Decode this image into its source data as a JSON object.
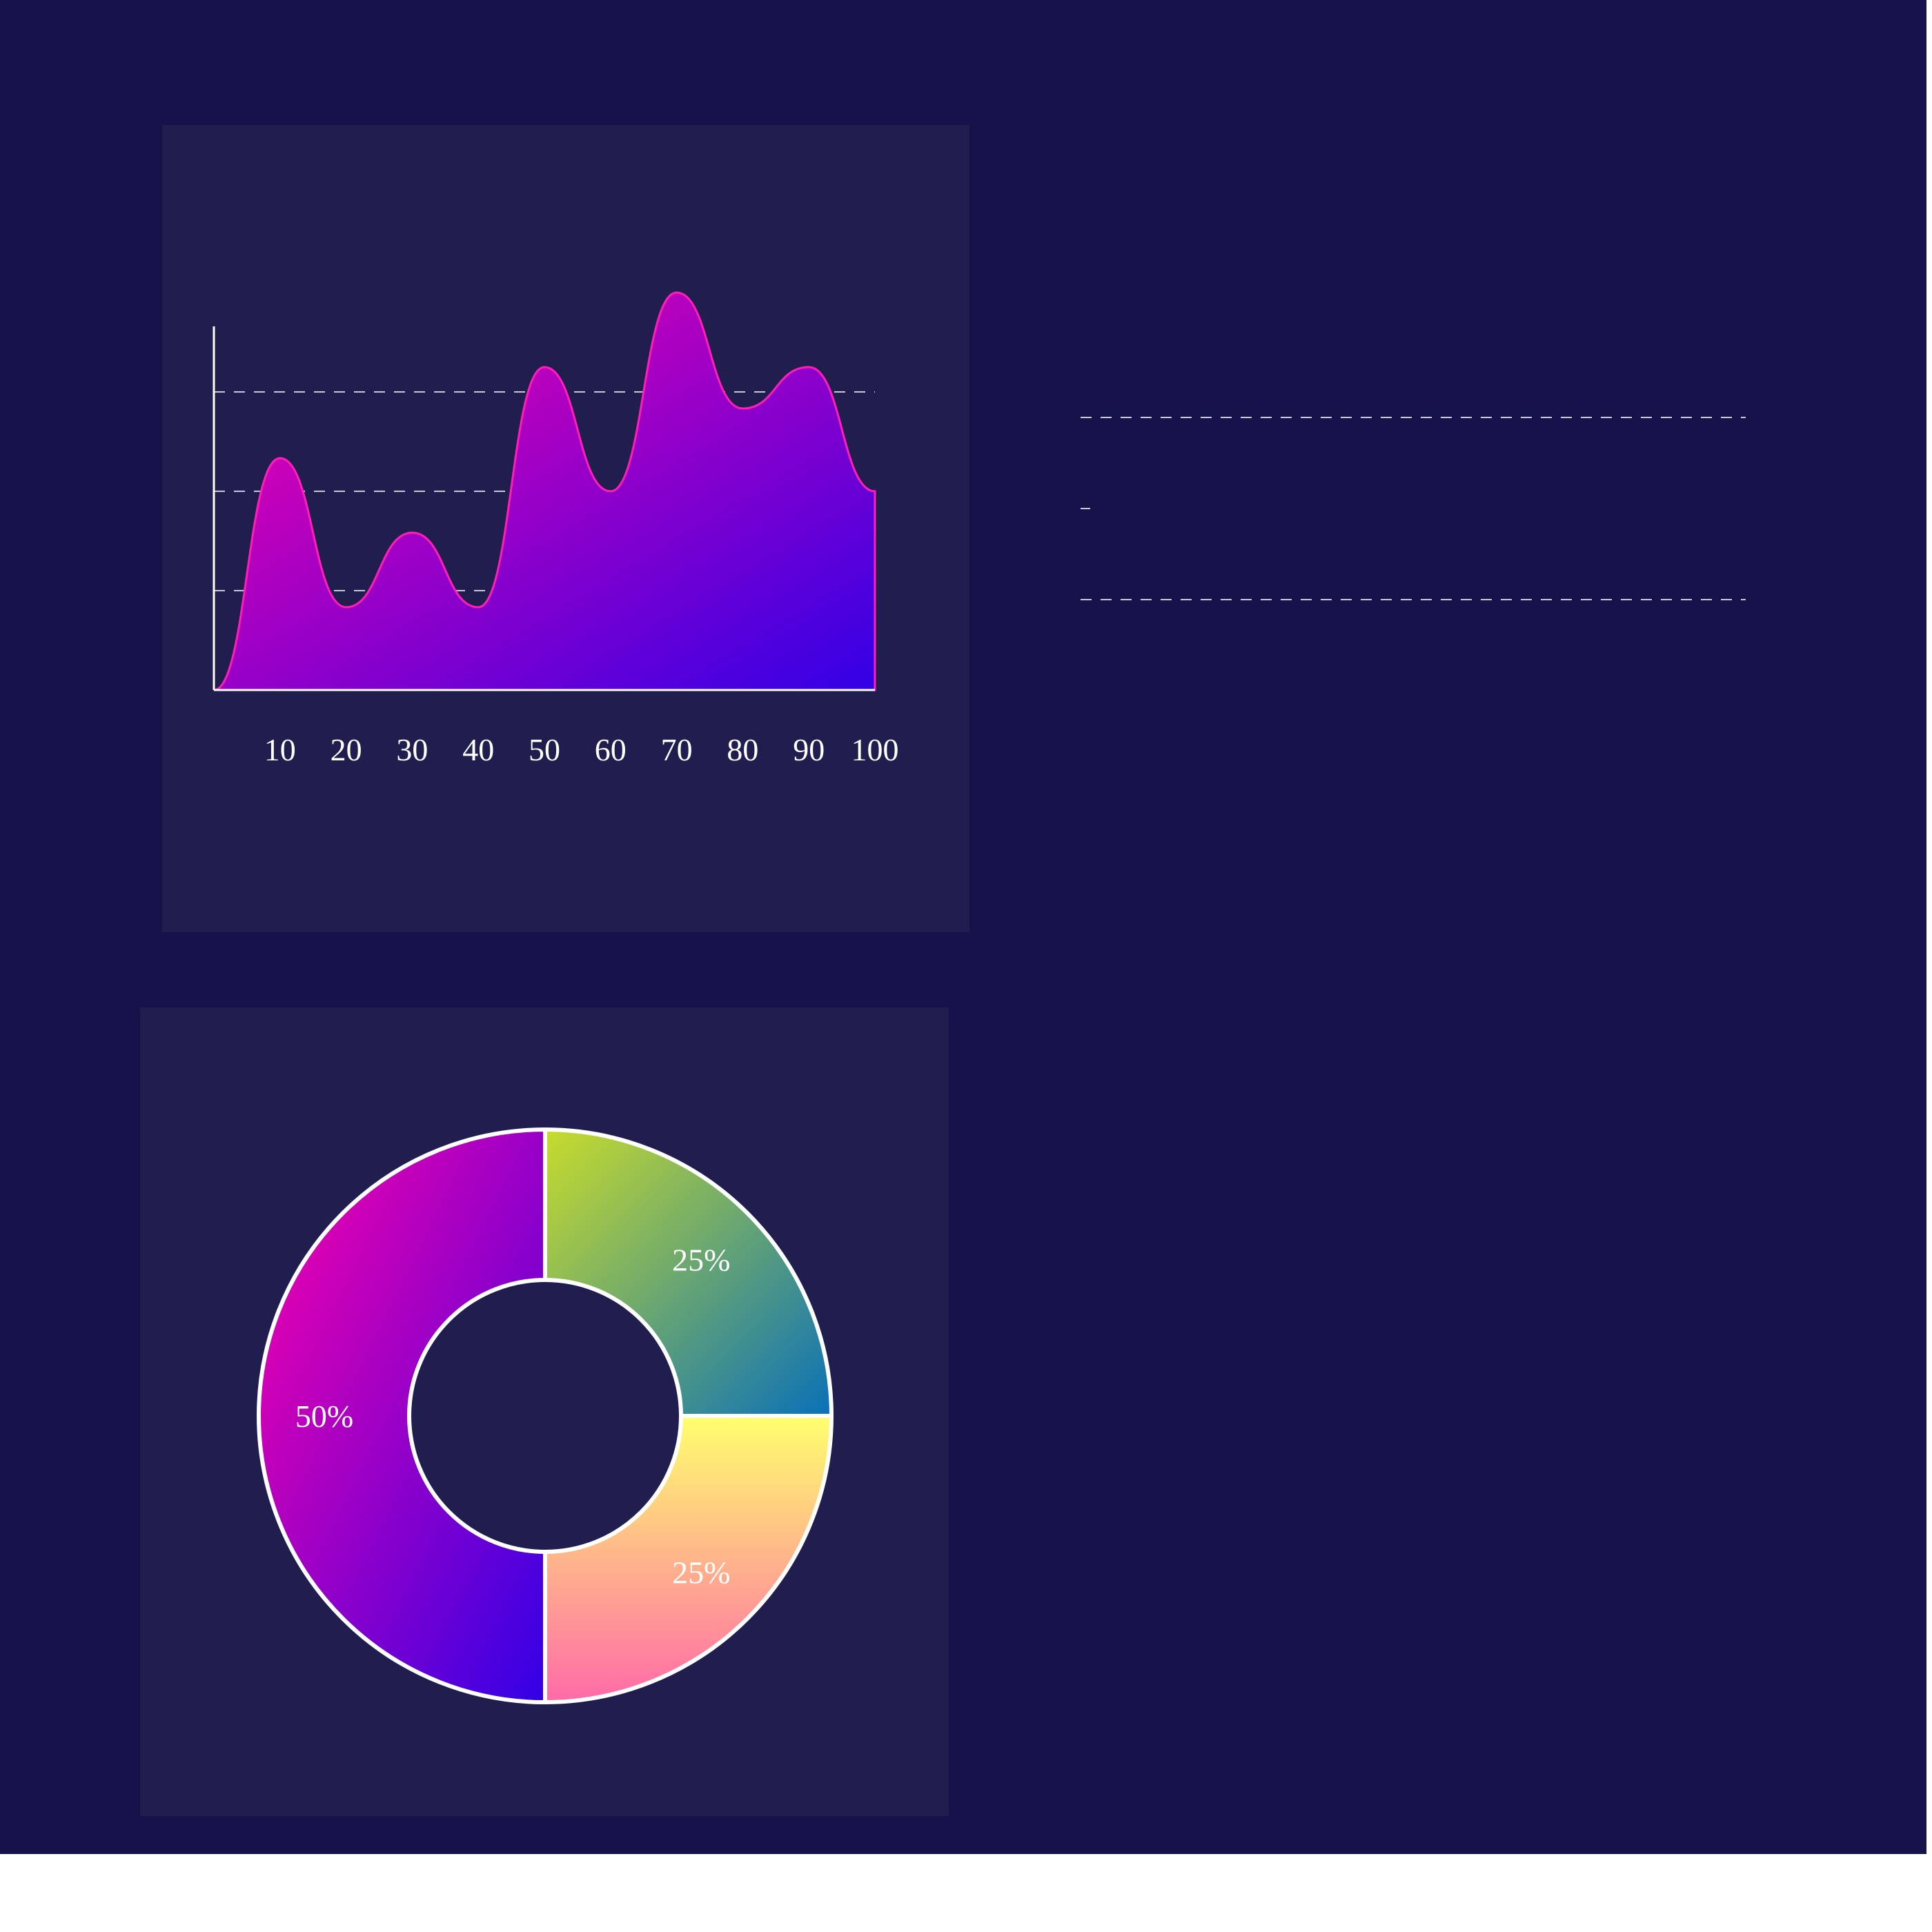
{
  "colors": {
    "background": "#15134a",
    "panel": "#201e4f",
    "axis": "#ffffff",
    "grid": "#c9c7d8",
    "area_start": "#ff00a8",
    "area_end": "#3200e6",
    "area_stroke": "#ff1fb8"
  },
  "chart_data": [
    {
      "type": "area",
      "x": [
        0,
        10,
        20,
        30,
        40,
        50,
        60,
        70,
        80,
        90,
        100
      ],
      "values": [
        0,
        28,
        10,
        19,
        10,
        39,
        24,
        48,
        34,
        39,
        24
      ],
      "xlabels": [
        "10",
        "20",
        "30",
        "40",
        "50",
        "60",
        "70",
        "80",
        "90",
        "100"
      ],
      "xlim": [
        0,
        100
      ],
      "ylim": [
        0,
        50
      ],
      "grid": "horizontal dashed",
      "title": "",
      "xlabel": "",
      "ylabel": ""
    },
    {
      "type": "pie",
      "variant": "donut",
      "slices": [
        {
          "label": "25%",
          "value": 25,
          "gradient": [
            "#c8dc2c",
            "#0a70b8"
          ]
        },
        {
          "label": "25%",
          "value": 25,
          "gradient": [
            "#ffff6e",
            "#ff6aa8"
          ]
        },
        {
          "label": "50%",
          "value": 50,
          "gradient": [
            "#ff00a8",
            "#3200e6"
          ]
        }
      ]
    }
  ]
}
